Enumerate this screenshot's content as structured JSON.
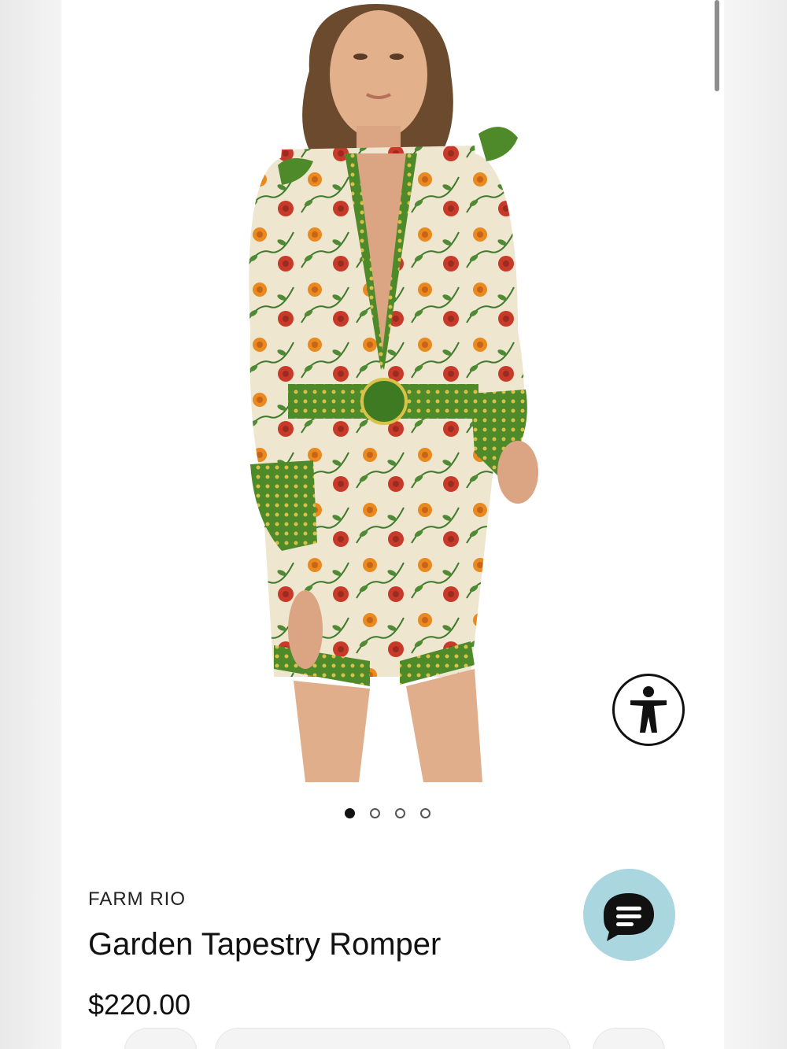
{
  "product": {
    "brand": "FARM RIO",
    "name": "Garden Tapestry Romper",
    "price": "$220.00"
  },
  "gallery": {
    "image_count": 4,
    "active_index": 0,
    "image_subject": "model wearing floral print romper"
  },
  "icons": {
    "accessibility": "accessibility-person-icon",
    "chat": "chat-bubble-icon"
  },
  "colors": {
    "chat_button_bg": "#a9d6df",
    "dot_active": "#111111",
    "text": "#111111"
  }
}
